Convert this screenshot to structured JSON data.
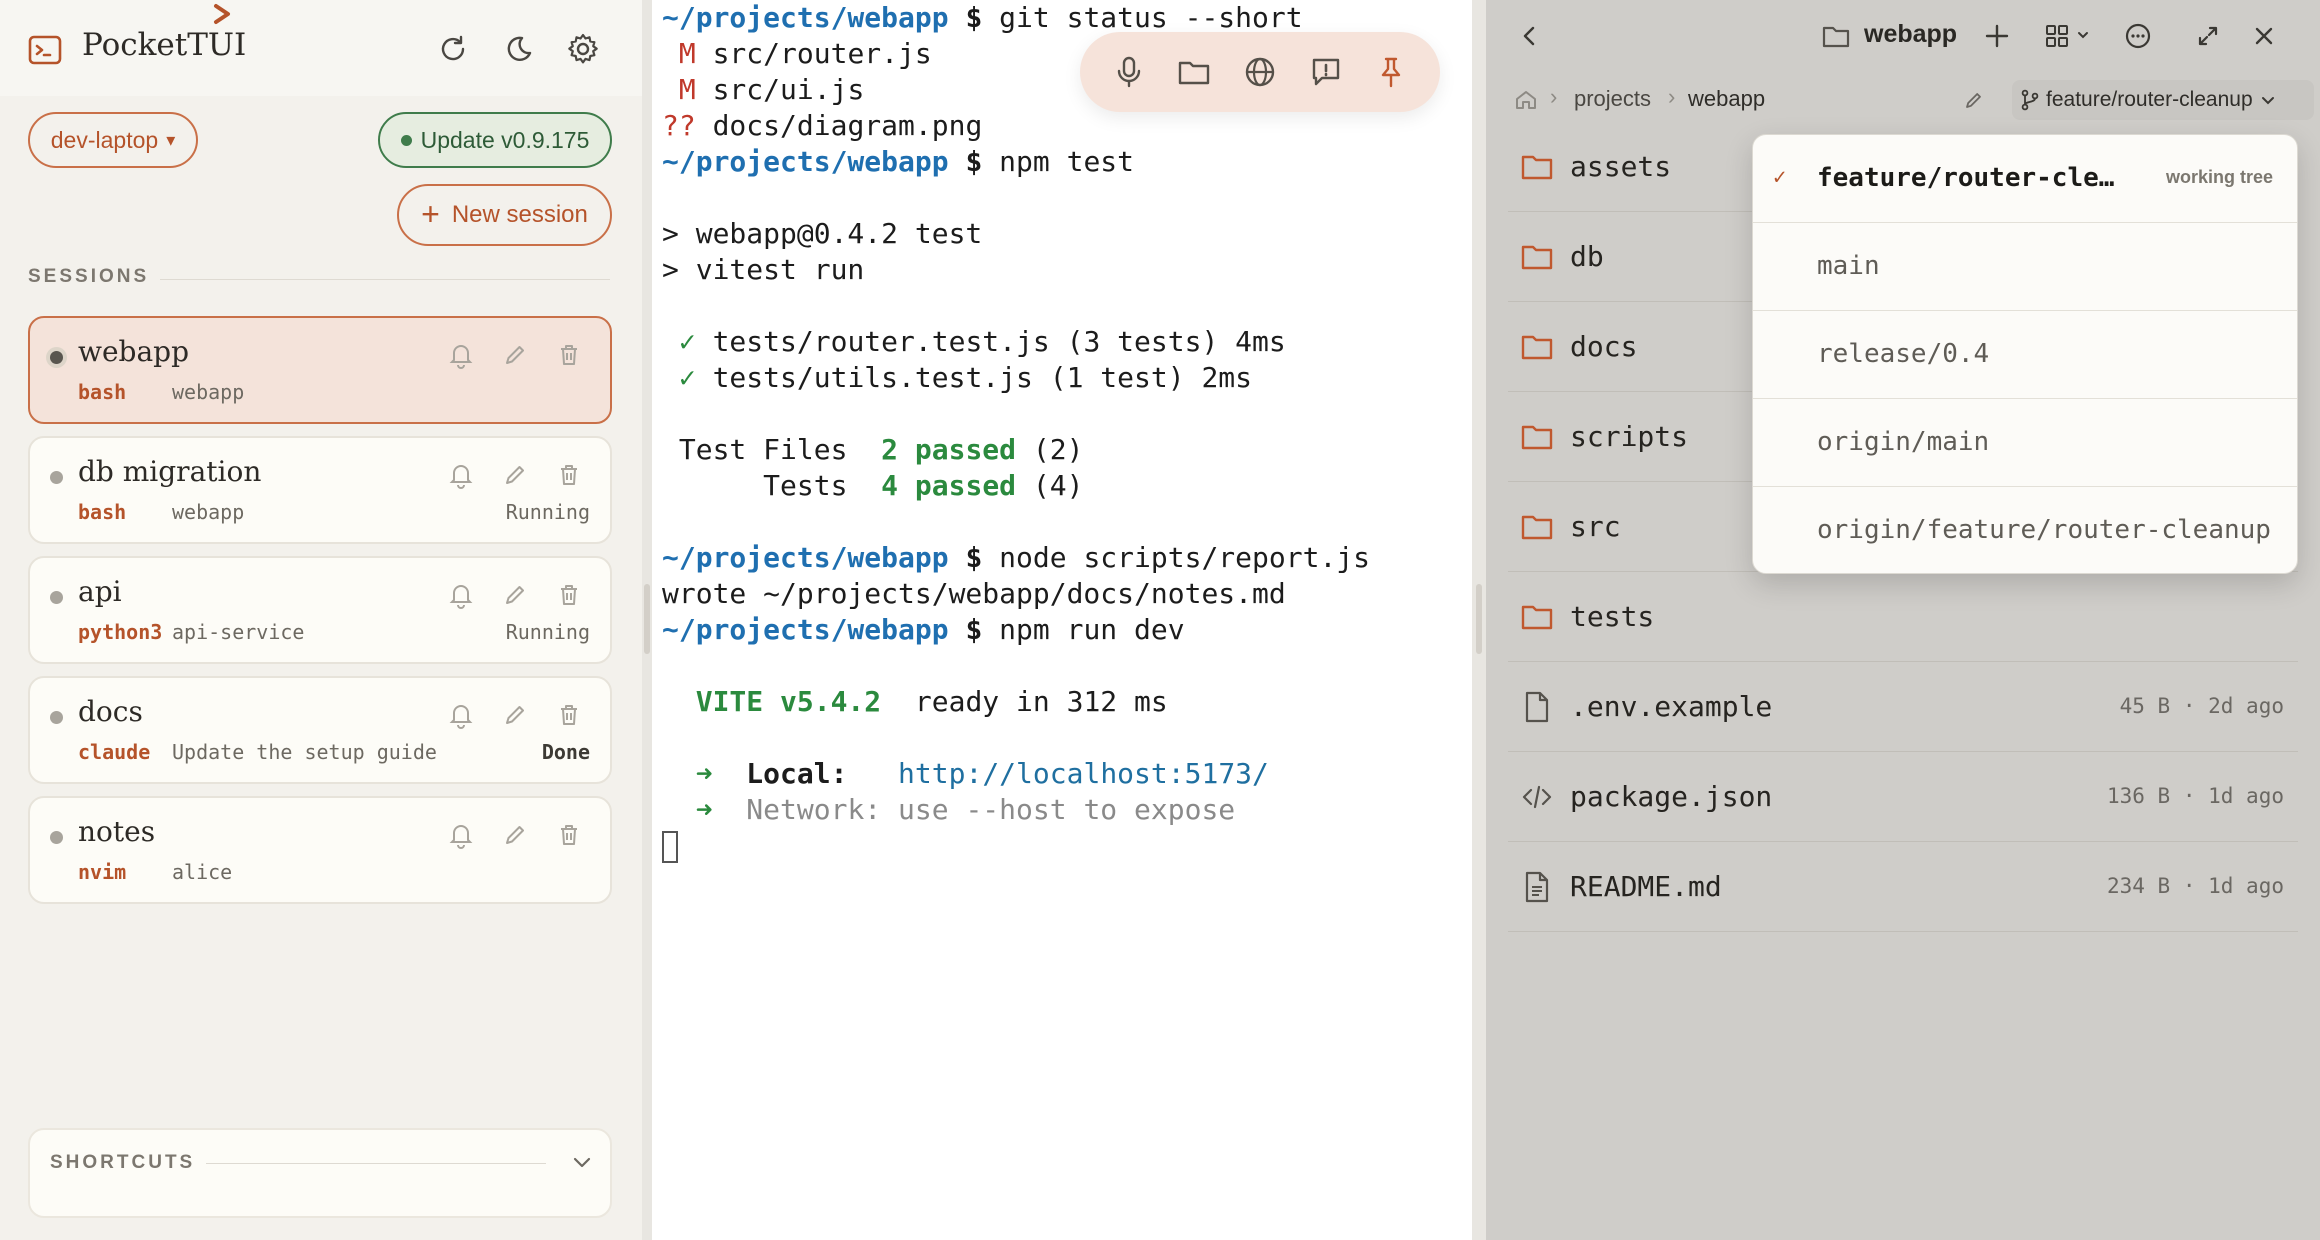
{
  "app": {
    "title": "PocketTUI"
  },
  "colors": {
    "accent": "#c97048",
    "success": "#3f7c4b",
    "path_blue": "#1f6fb0"
  },
  "sidebar": {
    "host": "dev-laptop",
    "host_caret": "▾",
    "update_label": "Update v0.9.175",
    "new_session_label": "New session",
    "sessions_heading": "SESSIONS",
    "sessions": [
      {
        "name": "webapp",
        "command": "bash",
        "cwd": "webapp",
        "status": "",
        "active": true
      },
      {
        "name": "db migration",
        "command": "bash",
        "cwd": "webapp",
        "status": "Running"
      },
      {
        "name": "api",
        "command": "python3",
        "cwd": "api-service",
        "status": "Running"
      },
      {
        "name": "docs",
        "command": "claude",
        "cwd": "Update the setup guide",
        "status": "Done"
      },
      {
        "name": "notes",
        "command": "nvim",
        "cwd": "alice",
        "status": ""
      }
    ],
    "shortcuts_label": "SHORTCUTS",
    "icons": [
      "terminal-logo-icon",
      "refresh-icon",
      "moon-icon",
      "gear-icon",
      "bell-icon",
      "pencil-icon",
      "trash-icon",
      "chevron-down-icon"
    ]
  },
  "terminal": {
    "prompt_path": "~/projects/webapp",
    "prompt_symbol": "$",
    "lines": {
      "cmd1": "git status --short",
      "st1_flag": "M",
      "st1_file": "src/router.js",
      "st2_flag": "M",
      "st2_file": "src/ui.js",
      "st3_flag": "??",
      "st3_file": "docs/diagram.png",
      "cmd2": "npm test",
      "npm1": "> webapp@0.4.2 test",
      "npm2": "> vitest run",
      "check": "✓",
      "t1": "tests/router.test.js (3 tests) 4ms",
      "t2": "tests/utils.test.js (1 test) 2ms",
      "files_label": "Test Files",
      "files_pass": "2 passed",
      "files_count": "(2)",
      "tests_label": "Tests",
      "tests_pass": "4 passed",
      "tests_count": "(4)",
      "cmd3": "node scripts/report.js",
      "wrote": "wrote ~/projects/webapp/docs/notes.md",
      "cmd4": "npm run dev",
      "vite": "VITE v5.4.2",
      "vite_ready": "ready in 312 ms",
      "arrow": "➜",
      "local_label": "Local:",
      "local_url": "http://localhost:5173/",
      "network": "Network: use --host to expose"
    },
    "toolbar_icons": [
      "microphone-icon",
      "folder-icon",
      "globe-icon",
      "feedback-icon",
      "pin-icon"
    ]
  },
  "files": {
    "title": "webapp",
    "breadcrumbs": [
      "projects",
      "webapp"
    ],
    "branch": "feature/router-cleanup",
    "items": [
      {
        "name": "assets",
        "type": "folder",
        "meta": ""
      },
      {
        "name": "db",
        "type": "folder",
        "meta": ""
      },
      {
        "name": "docs",
        "type": "folder",
        "meta": ""
      },
      {
        "name": "scripts",
        "type": "folder",
        "meta": ""
      },
      {
        "name": "src",
        "type": "folder",
        "meta": ""
      },
      {
        "name": "tests",
        "type": "folder",
        "meta": ""
      },
      {
        "name": ".env.example",
        "type": "file",
        "meta": "45 B · 2d ago"
      },
      {
        "name": "package.json",
        "type": "code",
        "meta": "136 B · 1d ago"
      },
      {
        "name": "README.md",
        "type": "doc",
        "meta": "234 B · 1d ago"
      }
    ],
    "branch_menu": [
      {
        "name": "feature/router-cle…",
        "current": true,
        "tag": "working tree",
        "check": "✓"
      },
      {
        "name": "main"
      },
      {
        "name": "release/0.4"
      },
      {
        "name": "origin/main"
      },
      {
        "name": "origin/feature/router-cleanup"
      }
    ]
  }
}
